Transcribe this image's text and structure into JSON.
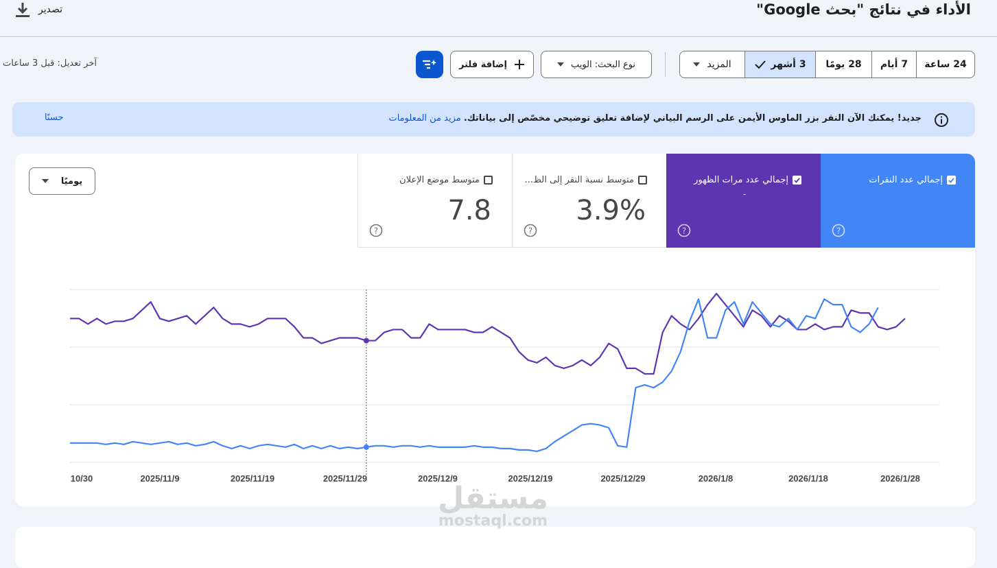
{
  "header": {
    "title": "الأداء في نتائج \"بحث Google\"",
    "export_label": "تصدير"
  },
  "toolbar": {
    "ranges": [
      {
        "label": "24 ساعة",
        "selected": false
      },
      {
        "label": "7 أيام",
        "selected": false
      },
      {
        "label": "28 يومًا",
        "selected": false
      },
      {
        "label": "3 أشهر",
        "selected": true
      }
    ],
    "more_label": "المزيد",
    "search_type_label": "نوع البحث: الويب",
    "add_filter_label": "إضافة فلتر",
    "last_modified": "آخر تعديل: قبل 3 ساعات"
  },
  "banner": {
    "message": "جديد! يمكنك الآن النقر بزر الماوس الأيمن على الرسم البياني لإضافة تعليق توضيحي مخصّص إلى بياناتك.",
    "link": "مزيد من المعلومات",
    "dismiss": "حسنًا"
  },
  "metrics": [
    {
      "label": "إجمالي عدد النقرات",
      "value": "",
      "checked": true,
      "color": "#4285f4"
    },
    {
      "label": "إجمالي عدد مرات الظهور",
      "value": "-",
      "checked": true,
      "color": "#5e35b1"
    },
    {
      "label": "متوسط نسبة النقر إلى الظ...",
      "value": "3.9%",
      "checked": false,
      "color": "#ffffff"
    },
    {
      "label": "متوسط موضع الإعلان",
      "value": "7.8",
      "checked": false,
      "color": "#ffffff"
    }
  ],
  "granularity": "يوميًا",
  "chart_data": {
    "type": "line",
    "x_ticks": [
      "10/30",
      "2025/11/9",
      "2025/11/19",
      "2025/11/29",
      "2025/12/9",
      "2025/12/19",
      "2025/12/29",
      "2026/1/8",
      "2026/1/18",
      "2026/1/28"
    ],
    "series": [
      {
        "color": "#5e35b1",
        "values": [
          51,
          51,
          49,
          51,
          49,
          50,
          50,
          51,
          54,
          57,
          51,
          50,
          51,
          52,
          49,
          52,
          55,
          51,
          49,
          49,
          48,
          49,
          51,
          51,
          51,
          48,
          44,
          44,
          42,
          43,
          44,
          44,
          44,
          43,
          43,
          46,
          47,
          47,
          44,
          44,
          49,
          47,
          47,
          47,
          47,
          46,
          46,
          48,
          46,
          44,
          39,
          36,
          35,
          37,
          34,
          33,
          34,
          36,
          34,
          37,
          42,
          40,
          33,
          33,
          31,
          31,
          46,
          52,
          49,
          47,
          51,
          56,
          60,
          56,
          52,
          48,
          54,
          52,
          48,
          52,
          50,
          47,
          47,
          49,
          47,
          48,
          48,
          54,
          53,
          53,
          48,
          47,
          48,
          51
        ]
      },
      {
        "color": "#4285f4",
        "values": [
          6,
          6,
          6,
          6,
          5.5,
          6,
          5.5,
          6.5,
          6,
          5.5,
          6,
          6.5,
          5.5,
          6,
          5,
          5.5,
          6.5,
          5,
          4,
          5,
          4,
          5,
          5.5,
          5,
          4.5,
          5.5,
          4,
          5,
          4,
          5,
          4,
          4.5,
          4,
          4.5,
          5,
          5,
          4.5,
          5,
          5,
          4.5,
          5,
          4.5,
          4.5,
          4.5,
          4.5,
          5,
          4.5,
          4.5,
          4,
          4,
          3.5,
          3.5,
          3,
          4,
          6.5,
          8.5,
          10.5,
          12.5,
          13,
          12.5,
          11.5,
          5,
          4.5,
          26,
          27,
          26,
          28,
          32,
          39,
          50,
          58,
          44,
          44,
          54,
          57,
          49,
          57,
          53,
          49,
          48,
          51,
          47,
          52,
          51,
          58,
          56,
          56,
          48,
          46,
          49,
          55
        ]
      }
    ],
    "highlight_index": 33
  },
  "watermark": {
    "arabic": "مستقل",
    "latin": "mostaql.com"
  }
}
